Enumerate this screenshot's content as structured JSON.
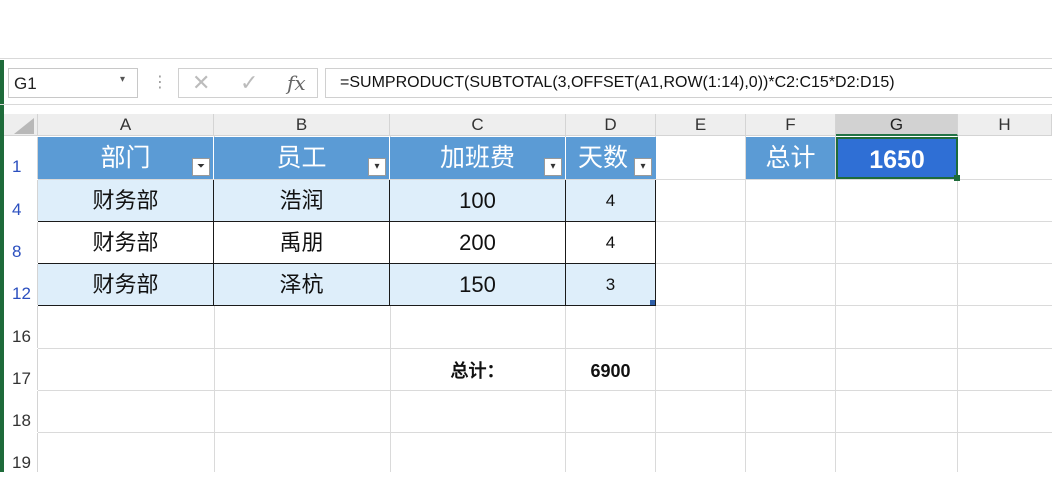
{
  "namebox": {
    "value": "G1"
  },
  "formula_bar": {
    "cancel_glyph": "✕",
    "enter_glyph": "✓",
    "fx_label": "fx",
    "formula": "=SUMPRODUCT(SUBTOTAL(3,OFFSET(A1,ROW(1:14),0))*C2:C15*D2:D15)"
  },
  "columns": [
    "A",
    "B",
    "C",
    "D",
    "E",
    "F",
    "G",
    "H"
  ],
  "rows": [
    "1",
    "4",
    "8",
    "12",
    "16",
    "17",
    "18",
    "19"
  ],
  "table": {
    "headers": [
      "部门",
      "员工",
      "加班费",
      "天数"
    ],
    "filter_glyphs": [
      "⏷",
      "▾",
      "▾",
      "▾"
    ],
    "data": [
      [
        "财务部",
        "浩润",
        "100",
        "4"
      ],
      [
        "财务部",
        "禹朋",
        "200",
        "4"
      ],
      [
        "财务部",
        "泽杭",
        "150",
        "3"
      ]
    ]
  },
  "summary": {
    "label": "总计：",
    "value": "6900"
  },
  "total_cell": {
    "label": "总计",
    "value": "1650"
  },
  "colors": {
    "header_blue": "#5b9bd5",
    "band_blue": "#deeefa",
    "selected_blue": "#2f6fd5",
    "excel_green": "#1e6b3a"
  }
}
